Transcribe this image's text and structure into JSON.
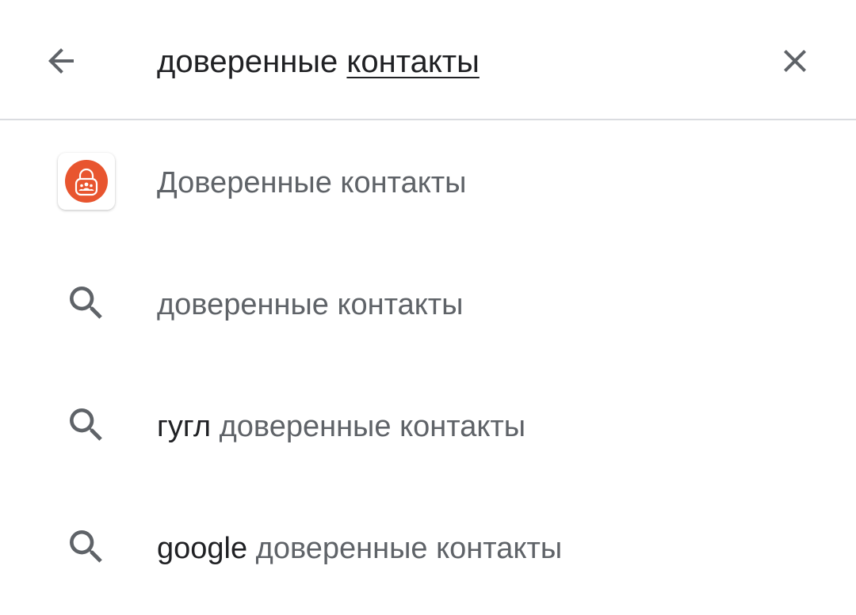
{
  "search": {
    "query_plain": "доверенные ",
    "query_composing": "контакты"
  },
  "icons": {
    "back": "arrow-left-icon",
    "clear": "close-icon",
    "suggestion": "search-icon",
    "app": "trusted-contacts-app-icon"
  },
  "colors": {
    "icon_gray": "#5f6368",
    "text_dark": "#202124",
    "text_gray": "#5f6368",
    "divider": "#dadce0",
    "app_orange": "#e8552f"
  },
  "suggestions": [
    {
      "type": "app",
      "prefix": "",
      "text": "Доверенные контакты"
    },
    {
      "type": "query",
      "prefix": "",
      "text": "доверенные контакты"
    },
    {
      "type": "query",
      "prefix": "гугл",
      "text": " доверенные контакты"
    },
    {
      "type": "query",
      "prefix": "google",
      "text": " доверенные контакты"
    }
  ]
}
